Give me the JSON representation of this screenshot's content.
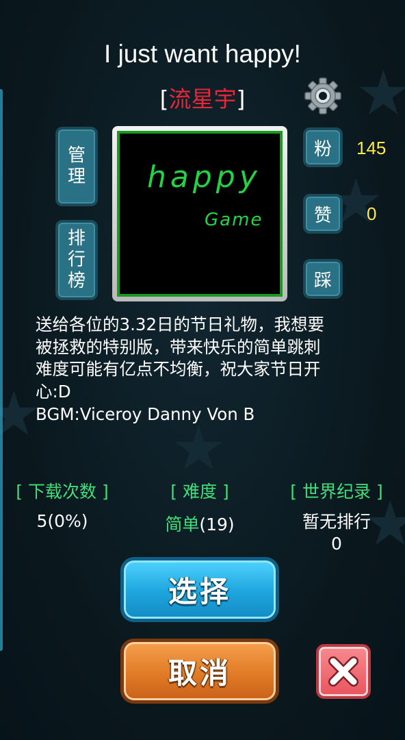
{
  "level": {
    "title": "I just want happy!",
    "author_open": "[",
    "author_name": "流星宇",
    "author_close": "]",
    "thumbnail_text_line1": "happy",
    "thumbnail_text_line2": "Game",
    "description": "送给各位的3.32日的节日礼物，我想要\n被拯救的特别版，带来快乐的简单跳刺\n难度可能有亿点不均衡，祝大家节日开\n心:D\nBGM:Viceroy Danny Von B"
  },
  "side_buttons": {
    "manage": "管理",
    "ranking": "排行榜"
  },
  "stats": {
    "fans_label": "粉",
    "fans_value": "145",
    "like_label": "赞",
    "like_value": "0",
    "dislike_label": "踩"
  },
  "info": {
    "downloads_header": "[ 下载次数 ]",
    "downloads_value": "5(0%)",
    "difficulty_header": "[ 难度 ]",
    "difficulty_level": "简单",
    "difficulty_count": "(19)",
    "record_header": "[ 世界纪录 ]",
    "record_line1": "暂无排行",
    "record_line2": "0"
  },
  "actions": {
    "select_label": "选择",
    "cancel_label": "取消"
  },
  "colors": {
    "author": "#e8263a",
    "headers": "#3fe07a",
    "stat_values": "#ffe94a",
    "select_button": "#1ea4dd",
    "cancel_button": "#e07b26",
    "close_button": "#e9545d"
  },
  "icons": {
    "settings": "gear-icon",
    "close": "close-icon"
  }
}
